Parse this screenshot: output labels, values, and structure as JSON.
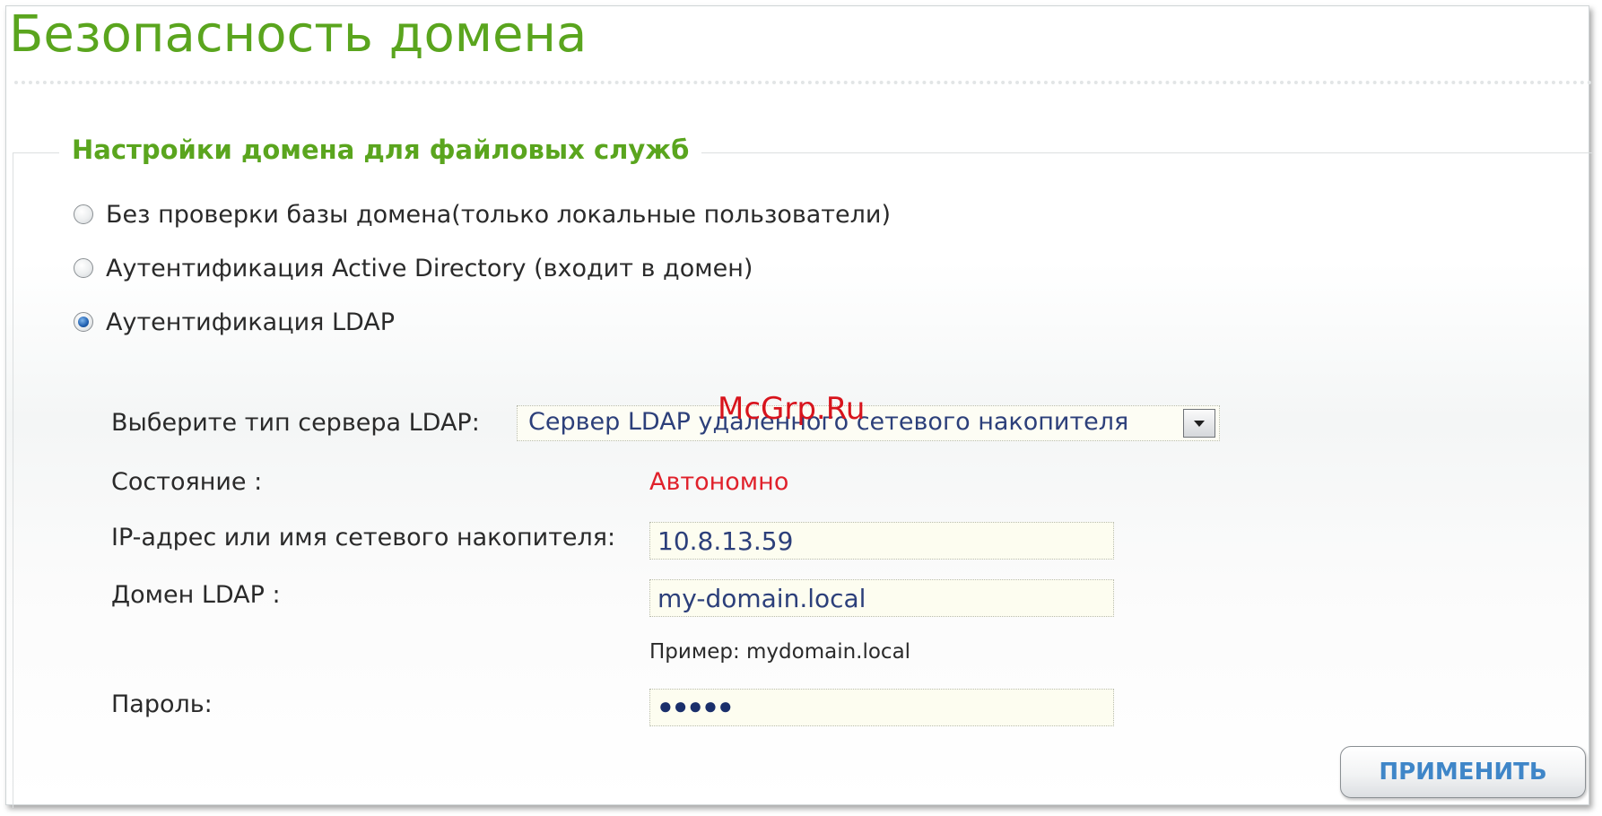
{
  "page": {
    "title": "Безопасность домена"
  },
  "fieldset": {
    "legend": "Настройки домена для файловых служб"
  },
  "auth_options": [
    {
      "label": "Без проверки базы домена(только локальные пользователи)",
      "selected": false
    },
    {
      "label": "Аутентификация Active Directory (входит в домен)",
      "selected": false
    },
    {
      "label": "Аутентификация LDAP",
      "selected": true
    }
  ],
  "ldap": {
    "server_type_label": "Выберите тип сервера LDAP:",
    "server_type_value": "Сервер LDAP удаленного сетевого накопителя",
    "status_label": "Состояние :",
    "status_value": "Автономно",
    "status_color": "#e0212b",
    "ip_label": "IP-адрес или имя сетевого накопителя:",
    "ip_value": "10.8.13.59",
    "domain_label": "Домен LDAP :",
    "domain_value": "my-domain.local",
    "domain_hint": "Пример: mydomain.local",
    "password_label": "Пароль:",
    "password_masked": "●●●●●"
  },
  "actions": {
    "apply_label": "ПРИМЕНИТЬ"
  },
  "watermark": "McGrp.Ru",
  "colors": {
    "accent_green": "#5aa51e",
    "link_blue": "#3f86c8",
    "input_text": "#2c3f7a"
  }
}
